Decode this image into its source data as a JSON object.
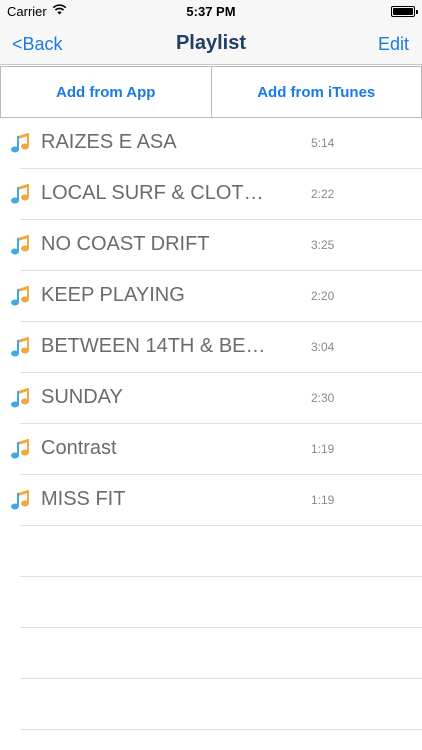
{
  "status_bar": {
    "carrier": "Carrier",
    "time": "5:37 PM",
    "wifi_icon": "wifi-icon",
    "battery_icon": "battery-icon"
  },
  "nav": {
    "back_label": "<Back",
    "title": "Playlist",
    "edit_label": "Edit"
  },
  "add_buttons": {
    "from_app": "Add from App",
    "from_itunes": "Add from iTunes"
  },
  "colors": {
    "accent": "#1a7ae6",
    "title": "#1f3f66",
    "track_text": "#6b6b6b"
  },
  "tracks": [
    {
      "title": "RAIZES E ASA",
      "duration": "5:14"
    },
    {
      "title": "LOCAL SURF & CLOT…",
      "duration": "2:22"
    },
    {
      "title": "NO COAST DRIFT",
      "duration": "3:25"
    },
    {
      "title": "KEEP PLAYING",
      "duration": "2:20"
    },
    {
      "title": "BETWEEN 14TH & BE…",
      "duration": "3:04"
    },
    {
      "title": "SUNDAY",
      "duration": "2:30"
    },
    {
      "title": "Contrast",
      "duration": "1:19"
    },
    {
      "title": "MISS FIT",
      "duration": "1:19"
    }
  ],
  "track_icon": "music-note-icon"
}
